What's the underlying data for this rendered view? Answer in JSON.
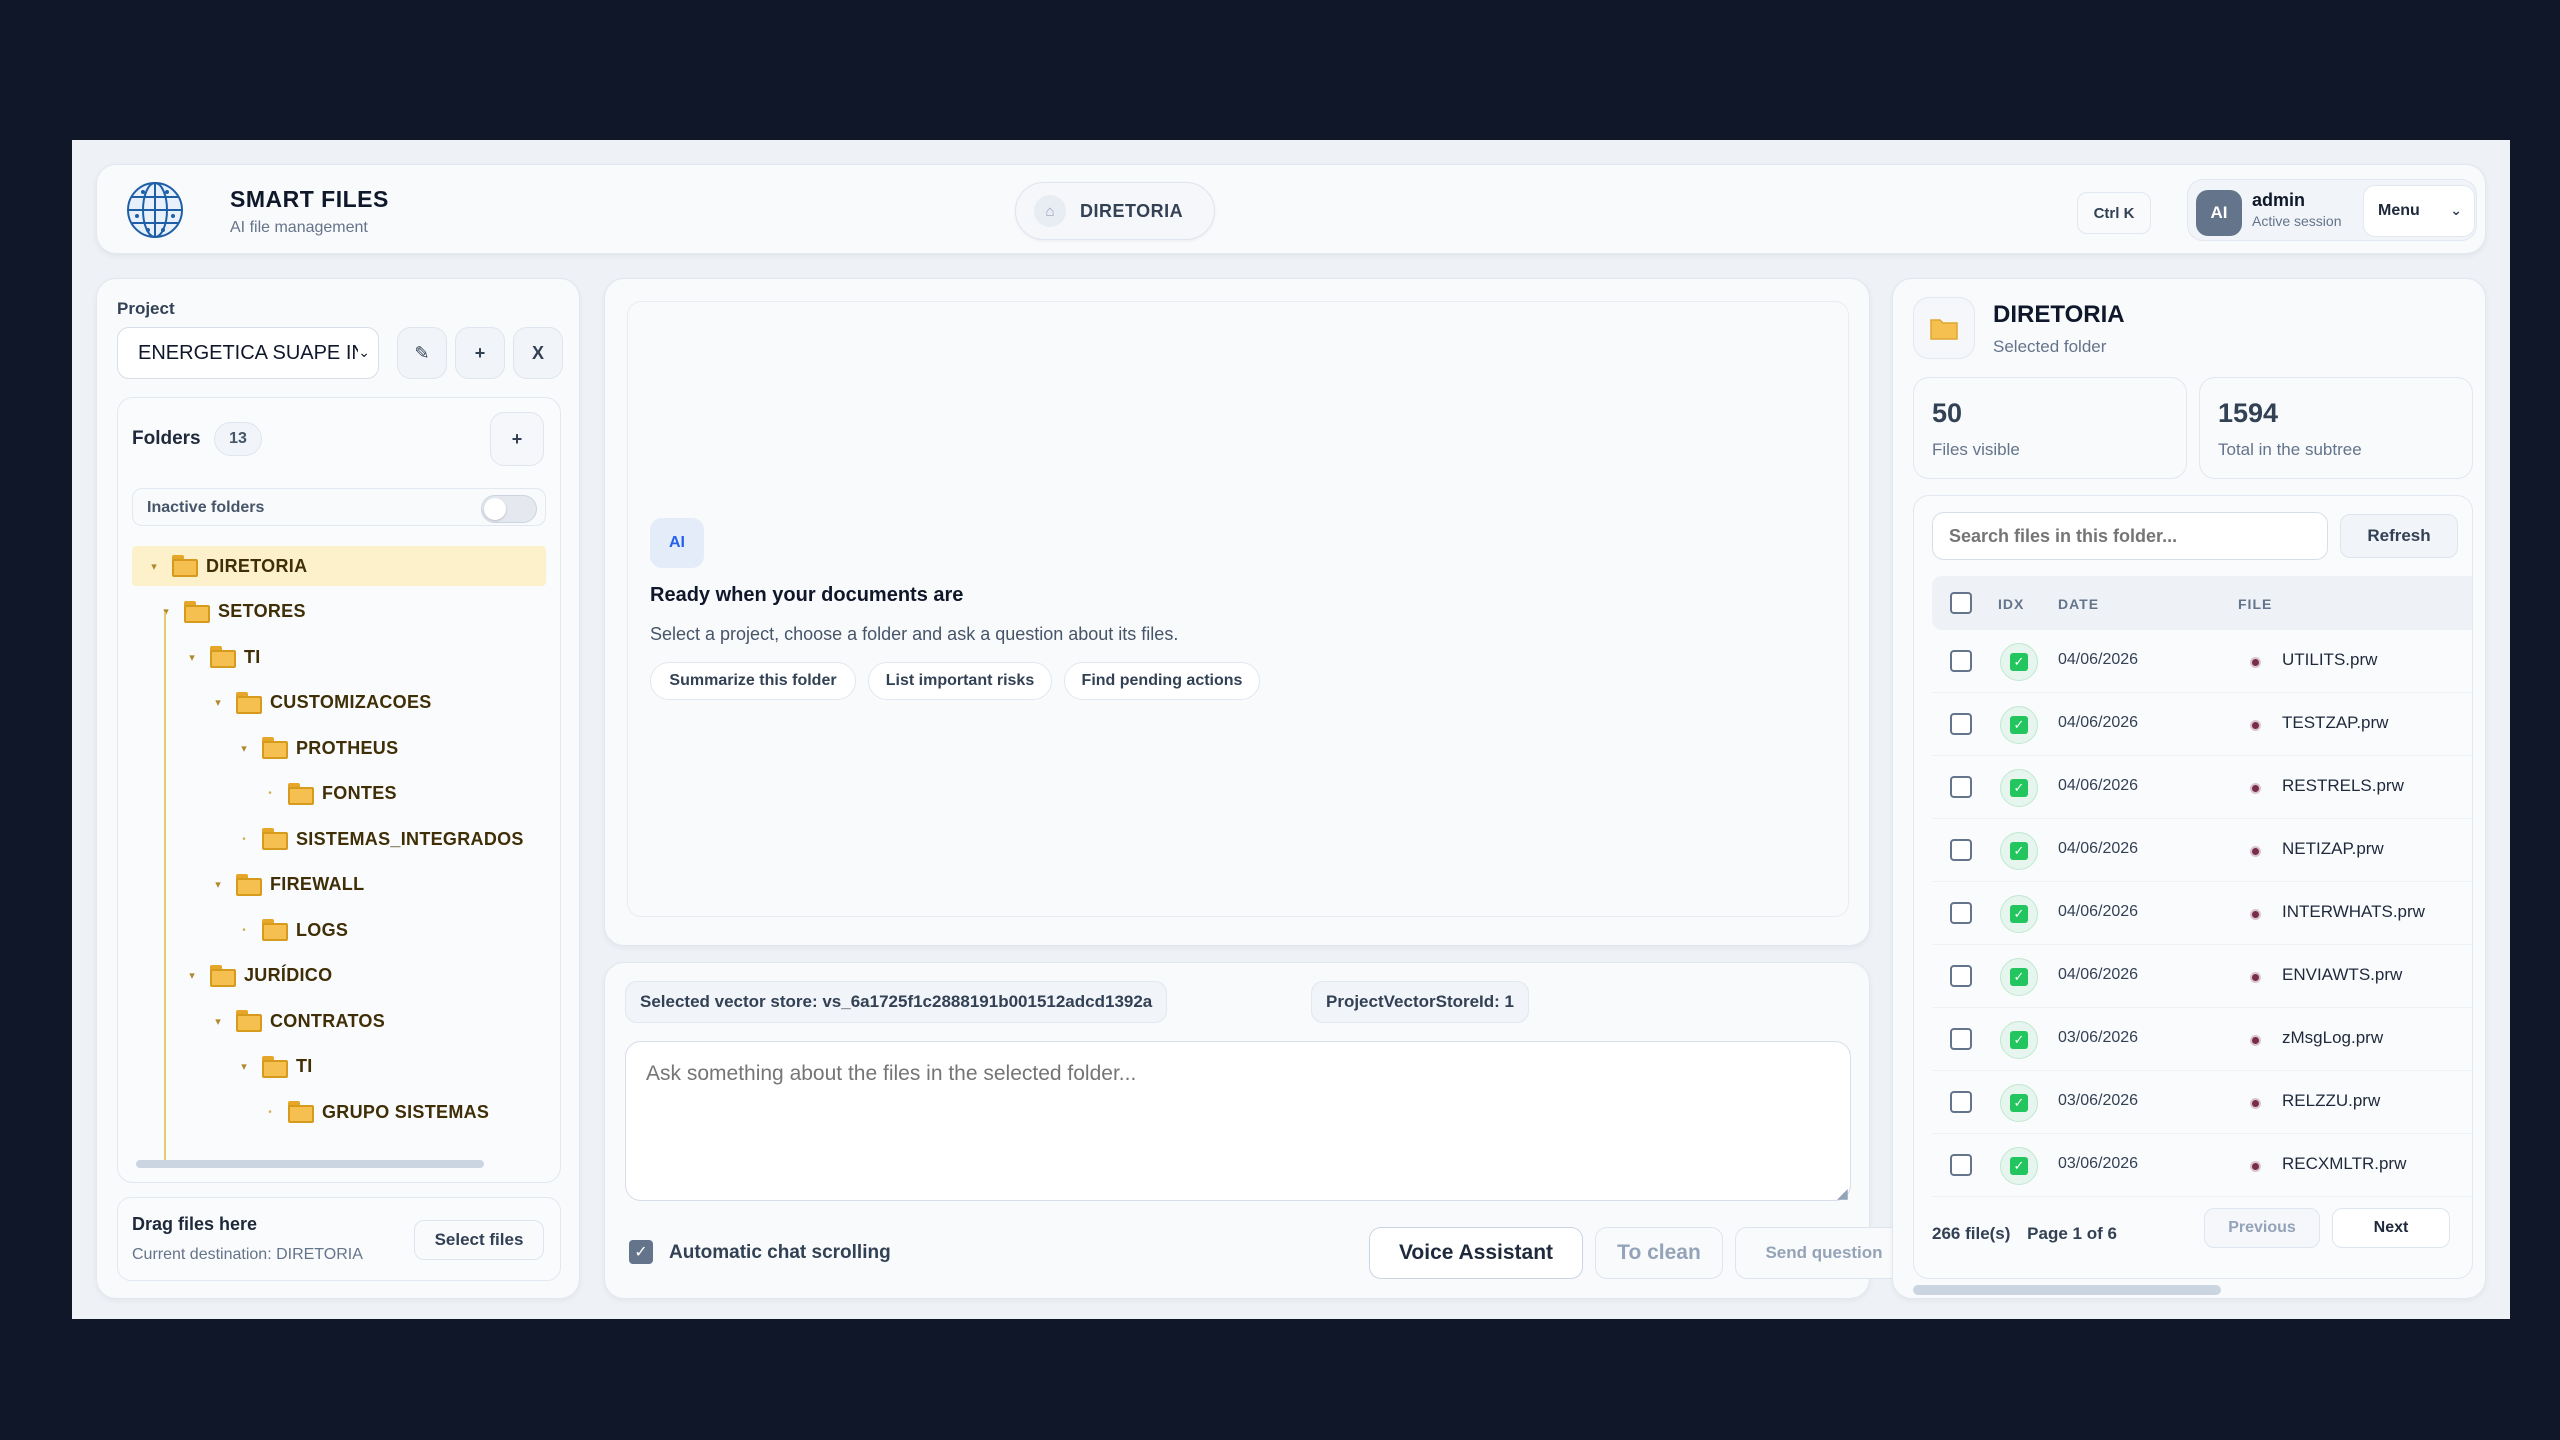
{
  "header": {
    "app_title": "SMART FILES",
    "app_subtitle": "AI file management",
    "breadcrumb": "DIRETORIA",
    "shortcut": "Ctrl K",
    "user": {
      "initials": "AI",
      "name": "admin",
      "status": "Active session"
    },
    "menu_label": "Menu"
  },
  "sidebar": {
    "project_label": "Project",
    "project_value": "ENERGETICA SUAPE IN",
    "edit_icon": "✎",
    "add_icon": "+",
    "close_icon": "X",
    "folders_title": "Folders",
    "folders_count": "13",
    "add_folder_icon": "+",
    "inactive_label": "Inactive folders",
    "inactive_enabled": false,
    "tree": [
      {
        "name": "DIRETORIA",
        "depth": 0,
        "expanded": true,
        "selected": true
      },
      {
        "name": "SETORES",
        "depth": 1,
        "expanded": true
      },
      {
        "name": "TI",
        "depth": 2,
        "expanded": true
      },
      {
        "name": "CUSTOMIZACOES",
        "depth": 3,
        "expanded": true
      },
      {
        "name": "PROTHEUS",
        "depth": 4,
        "expanded": true
      },
      {
        "name": "FONTES",
        "depth": 5,
        "leaf": true
      },
      {
        "name": "SISTEMAS_INTEGRADOS",
        "depth": 4,
        "leaf": true
      },
      {
        "name": "FIREWALL",
        "depth": 3,
        "expanded": true
      },
      {
        "name": "LOGS",
        "depth": 4,
        "leaf": true
      },
      {
        "name": "JURÍDICO",
        "depth": 2,
        "expanded": true
      },
      {
        "name": "CONTRATOS",
        "depth": 3,
        "expanded": true
      },
      {
        "name": "TI",
        "depth": 4,
        "expanded": true
      },
      {
        "name": "GRUPO SISTEMAS",
        "depth": 5,
        "leaf": true
      }
    ],
    "drop_title": "Drag files here",
    "drop_destination": "Current destination: DIRETORIA",
    "select_files_label": "Select files"
  },
  "chat": {
    "ai_badge": "AI",
    "ready_title": "Ready when your documents are",
    "ready_subtitle": "Select a project, choose a folder and ask a question about its files.",
    "suggestions": [
      "Summarize this folder",
      "List important risks",
      "Find pending actions"
    ],
    "vector_store_tag": "Selected vector store: vs_6a1725f1c2888191b001512adcd1392a",
    "project_vector_tag": "ProjectVectorStoreId: 1",
    "question_placeholder": "Ask something about the files in the selected folder...",
    "auto_scroll_label": "Automatic chat scrolling",
    "auto_scroll_checked": true,
    "voice_label": "Voice Assistant",
    "clean_label": "To clean",
    "send_label": "Send question"
  },
  "files_panel": {
    "folder_name": "DIRETORIA",
    "folder_caption": "Selected folder",
    "stats": [
      {
        "value": "50",
        "label": "Files visible"
      },
      {
        "value": "1594",
        "label": "Total in the subtree"
      }
    ],
    "search_placeholder": "Search files in this folder...",
    "refresh_label": "Refresh",
    "columns": {
      "idx": "IDX",
      "date": "DATE",
      "file": "FILE"
    },
    "files": [
      {
        "date": "04/06/2026",
        "name": "UTILITS.prw"
      },
      {
        "date": "04/06/2026",
        "name": "TESTZAP.prw"
      },
      {
        "date": "04/06/2026",
        "name": "RESTRELS.prw"
      },
      {
        "date": "04/06/2026",
        "name": "NETIZAP.prw"
      },
      {
        "date": "04/06/2026",
        "name": "INTERWHATS.prw"
      },
      {
        "date": "04/06/2026",
        "name": "ENVIAWTS.prw"
      },
      {
        "date": "03/06/2026",
        "name": "zMsgLog.prw"
      },
      {
        "date": "03/06/2026",
        "name": "RELZZU.prw"
      },
      {
        "date": "03/06/2026",
        "name": "RECXMLTR.prw"
      }
    ],
    "file_count": "266 file(s)",
    "page_info": "Page 1 of 6",
    "previous_label": "Previous",
    "next_label": "Next"
  },
  "colors": {
    "background": "#0f1729",
    "folder_selected": "#fdf1cc",
    "folder_icon": "#f5c04f",
    "status_ok": "#22c55e",
    "accent_blue": "#2563eb"
  }
}
